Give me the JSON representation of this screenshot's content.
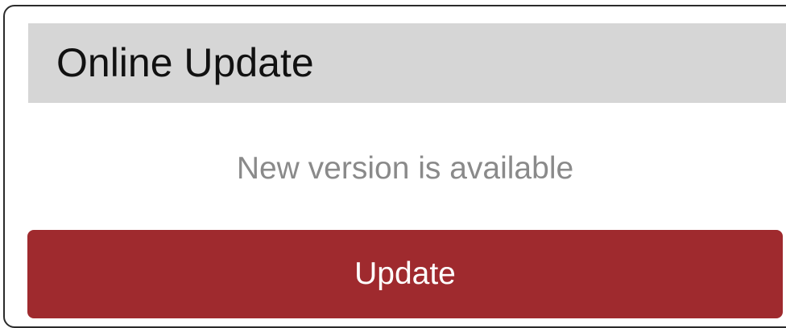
{
  "dialog": {
    "title": "Online Update",
    "message": "New version is available",
    "update_label": "Update"
  },
  "colors": {
    "header_background": "#d6d6d6",
    "button_background": "#9f2a2e",
    "button_text": "#ffffff",
    "message_text": "#8a8a8a",
    "title_text": "#111111"
  }
}
